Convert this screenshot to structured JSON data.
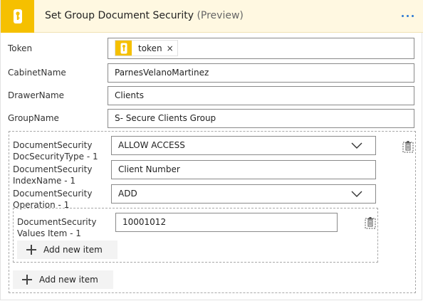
{
  "header": {
    "title": "Set Group Document Security",
    "preview": "(Preview)",
    "icon": "lock-icon",
    "more": "more-options-icon",
    "accent": "#f5c000"
  },
  "fields": {
    "token": {
      "label": "Token",
      "pill": "token",
      "pill_remove": "×"
    },
    "cabinet": {
      "label": "CabinetName",
      "value": "ParnesVelanoMartinez"
    },
    "drawer": {
      "label": "DrawerName",
      "value": "Clients"
    },
    "group": {
      "label": "GroupName",
      "value": "S- Secure Clients Group"
    }
  },
  "document_security": {
    "doc_type": {
      "label_line1": "DocumentSecurity",
      "label_line2": "DocSecurityType - 1",
      "value": "ALLOW ACCESS"
    },
    "index_name": {
      "label_line1": "DocumentSecurity",
      "label_line2": "IndexName - 1",
      "value": "Client Number"
    },
    "operation": {
      "label_line1": "DocumentSecurity",
      "label_line2": "Operation - 1",
      "value": "ADD"
    },
    "values_item": {
      "label_line1": "DocumentSecurity",
      "label_line2": "Values Item - 1",
      "value": "10001012"
    },
    "add_inner": "Add new item",
    "add_outer": "Add new item"
  }
}
